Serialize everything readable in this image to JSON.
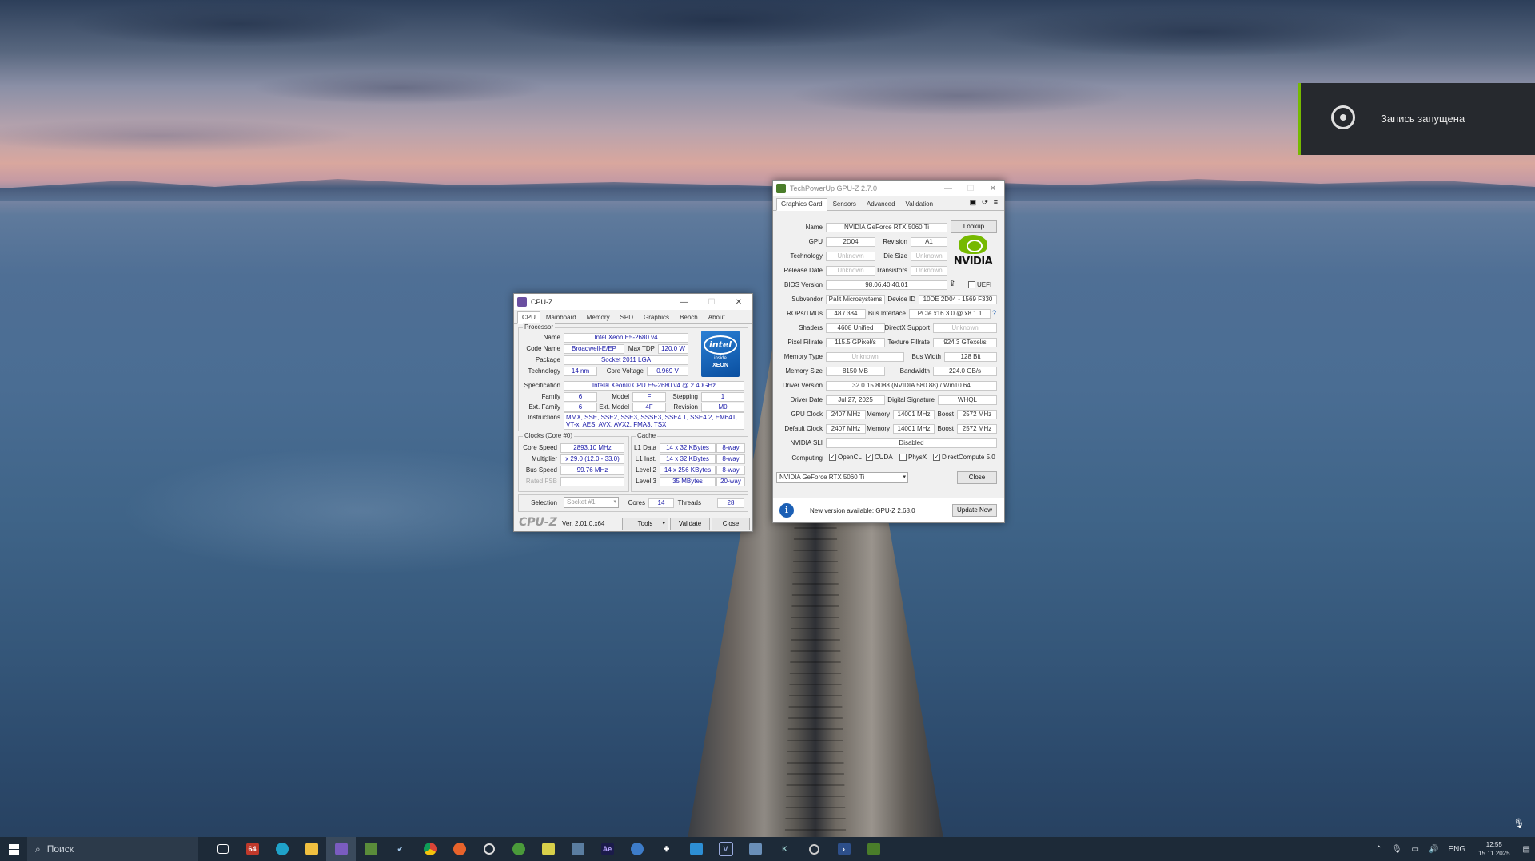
{
  "notification": {
    "text": "Запись запущена"
  },
  "cpuz": {
    "title": "CPU-Z",
    "tabs": [
      "CPU",
      "Mainboard",
      "Memory",
      "SPD",
      "Graphics",
      "Bench",
      "About"
    ],
    "processor_group": "Processor",
    "name_label": "Name",
    "name": "Intel Xeon E5-2680 v4",
    "codename_label": "Code Name",
    "codename": "Broadwell-E/EP",
    "maxtdp_label": "Max TDP",
    "maxtdp": "120.0 W",
    "package_label": "Package",
    "package": "Socket 2011 LGA",
    "technology_label": "Technology",
    "technology": "14 nm",
    "corevoltage_label": "Core Voltage",
    "corevoltage": "0.969 V",
    "spec_label": "Specification",
    "spec": "Intel® Xeon® CPU E5-2680 v4 @ 2.40GHz",
    "family_label": "Family",
    "family": "6",
    "model_label": "Model",
    "model": "F",
    "stepping_label": "Stepping",
    "stepping": "1",
    "extfamily_label": "Ext. Family",
    "extfamily": "6",
    "extmodel_label": "Ext. Model",
    "extmodel": "4F",
    "revision_label": "Revision",
    "revision": "M0",
    "instructions_label": "Instructions",
    "instructions": "MMX, SSE, SSE2, SSE3, SSSE3, SSE4.1, SSE4.2, EM64T, VT-x, AES, AVX, AVX2, FMA3, TSX",
    "intel_logo": {
      "brand": "intel",
      "inside": "inside",
      "product": "XEON"
    },
    "clocks_group": "Clocks (Core #0)",
    "corespeed_label": "Core Speed",
    "corespeed": "2893.10 MHz",
    "multiplier_label": "Multiplier",
    "multiplier": "x 29.0 (12.0 - 33.0)",
    "busspeed_label": "Bus Speed",
    "busspeed": "99.76 MHz",
    "ratedfsb_label": "Rated FSB",
    "cache_group": "Cache",
    "l1data_label": "L1 Data",
    "l1data": "14 x 32 KBytes",
    "l1data_way": "8-way",
    "l1inst_label": "L1 Inst.",
    "l1inst": "14 x 32 KBytes",
    "l1inst_way": "8-way",
    "l2_label": "Level 2",
    "l2": "14 x 256 KBytes",
    "l2_way": "8-way",
    "l3_label": "Level 3",
    "l3": "35 MBytes",
    "l3_way": "20-way",
    "selection_label": "Selection",
    "selection": "Socket #1",
    "cores_label": "Cores",
    "cores": "14",
    "threads_label": "Threads",
    "threads": "28",
    "logo": "CPU-Z",
    "version": "Ver. 2.01.0.x64",
    "tools_btn": "Tools",
    "validate_btn": "Validate",
    "close_btn": "Close"
  },
  "gpuz": {
    "title": "TechPowerUp GPU-Z 2.7.0",
    "tabs": [
      "Graphics Card",
      "Sensors",
      "Advanced",
      "Validation"
    ],
    "name_label": "Name",
    "name": "NVIDIA GeForce RTX 5060 Ti",
    "lookup_btn": "Lookup",
    "gpu_label": "GPU",
    "gpu": "2D04",
    "revision_label": "Revision",
    "revision": "A1",
    "technology_label": "Technology",
    "technology": "Unknown",
    "diesize_label": "Die Size",
    "diesize": "Unknown",
    "releasedate_label": "Release Date",
    "releasedate": "Unknown",
    "transistors_label": "Transistors",
    "transistors": "Unknown",
    "bios_label": "BIOS Version",
    "bios": "98.06.40.40.01",
    "uefi_label": "UEFI",
    "subvendor_label": "Subvendor",
    "subvendor": "Palit Microsystems",
    "deviceid_label": "Device ID",
    "deviceid": "10DE 2D04 - 1569 F330",
    "rops_label": "ROPs/TMUs",
    "rops": "48 / 384",
    "businterface_label": "Bus Interface",
    "businterface": "PCIe x16 3.0 @ x8 1.1",
    "help_glyph": "?",
    "shaders_label": "Shaders",
    "shaders": "4608 Unified",
    "directx_label": "DirectX Support",
    "directx": "Unknown",
    "pixelfill_label": "Pixel Fillrate",
    "pixelfill": "115.5 GPixel/s",
    "texturefill_label": "Texture Fillrate",
    "texturefill": "924.3 GTexel/s",
    "memtype_label": "Memory Type",
    "memtype": "Unknown",
    "buswidth_label": "Bus Width",
    "buswidth": "128 Bit",
    "memsize_label": "Memory Size",
    "memsize": "8150 MB",
    "bandwidth_label": "Bandwidth",
    "bandwidth": "224.0 GB/s",
    "driverver_label": "Driver Version",
    "driverver": "32.0.15.8088 (NVIDIA 580.88) / Win10 64",
    "driverdate_label": "Driver Date",
    "driverdate": "Jul 27, 2025",
    "digsig_label": "Digital Signature",
    "digsig": "WHQL",
    "gpuclock_label": "GPU Clock",
    "gpuclock": "2407 MHz",
    "memory_label": "Memory",
    "memclock": "14001 MHz",
    "boost_label": "Boost",
    "boost": "2572 MHz",
    "defclock_label": "Default Clock",
    "defclock": "2407 MHz",
    "defmem": "14001 MHz",
    "defboost": "2572 MHz",
    "sli_label": "NVIDIA SLI",
    "sli": "Disabled",
    "computing_label": "Computing",
    "opencl": "OpenCL",
    "cuda": "CUDA",
    "physx": "PhysX",
    "directcompute": "DirectCompute 5.0",
    "logo": "NVIDIA",
    "card_select": "NVIDIA GeForce RTX 5060 Ti",
    "close_btn": "Close",
    "update_text": "New version available: GPU-Z 2.68.0",
    "update_btn": "Update Now"
  },
  "taskbar": {
    "search_placeholder": "Поиск",
    "lang": "ENG",
    "time": "12:55",
    "date": "15.11.2025",
    "apps": [
      "task-view",
      "app-64",
      "edge",
      "explorer",
      "app-purple",
      "app-green",
      "steam",
      "chrome",
      "firefox",
      "app-c",
      "xbox",
      "notepad",
      "calculator",
      "after-effects",
      "app-globe",
      "app-plus",
      "app-blue",
      "visual-studio",
      "app-floppy",
      "app-k",
      "app-gear",
      "powershell",
      "app-green2"
    ]
  }
}
